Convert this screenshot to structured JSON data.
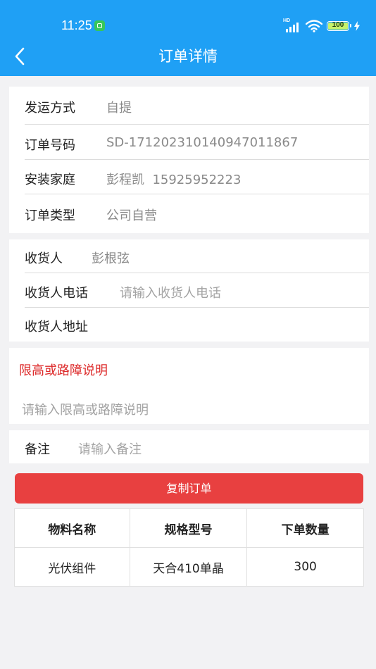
{
  "status_bar": {
    "time": "11:25",
    "battery": "100",
    "hd": "HD"
  },
  "header": {
    "title": "订单详情",
    "back_icon": "chevron-left-icon"
  },
  "order_info": [
    {
      "label": "发运方式",
      "value": "自提"
    },
    {
      "label": "订单号码",
      "value": "SD-171202310140947011867"
    },
    {
      "label": "安装家庭",
      "value": "彭程凯  15925952223"
    },
    {
      "label": "订单类型",
      "value": "公司自营"
    }
  ],
  "consignee": {
    "name_label": "收货人",
    "name_value": "彭根弦",
    "phone_label": "收货人电话",
    "phone_placeholder": "请输入收货人电话",
    "address_label": "收货人地址"
  },
  "restriction": {
    "title": "限高或路障说明",
    "placeholder": "请输入限高或路障说明"
  },
  "remark": {
    "label": "备注",
    "placeholder": "请输入备注"
  },
  "copy_button": "复制订单",
  "materials_table": {
    "headers": [
      "物料名称",
      "规格型号",
      "下单数量"
    ],
    "rows": [
      [
        "光伏组件",
        "天合410单晶",
        "300"
      ]
    ]
  },
  "colors": {
    "header_bg": "#1fa0f5",
    "accent_red": "#e84040",
    "title_red": "#dd2a2a"
  }
}
